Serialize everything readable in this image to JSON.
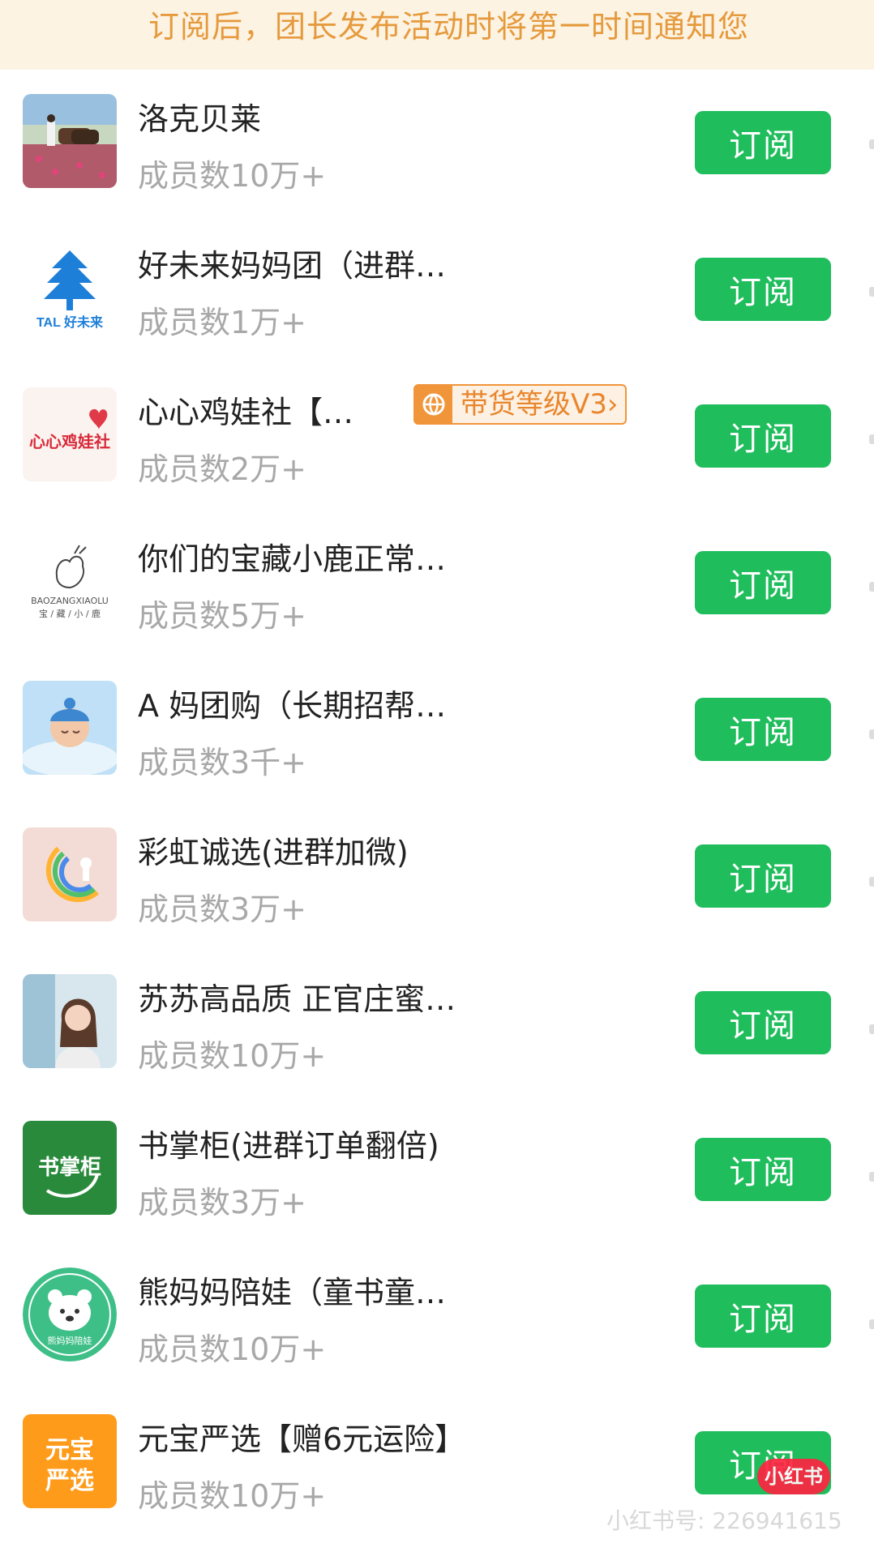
{
  "banner": {
    "text": "订阅后，团长发布活动时将第一时间通知您"
  },
  "subscribe_label": "订阅",
  "accent_color": "#1fbd5c",
  "groups": [
    {
      "name": "洛克贝莱",
      "members": "成员数10万+"
    },
    {
      "name": "好未来妈妈团（进群…",
      "members": "成员数1万+",
      "logo_text": "TAL 好未来"
    },
    {
      "name": "心心鸡娃社【…",
      "members": "成员数2万+",
      "badge": "带货等级V3›",
      "logo_text": "心心鸡娃社"
    },
    {
      "name": "你们的宝藏小鹿正常…",
      "members": "成员数5万+",
      "logo_text": "BAOZANGXIAOLU",
      "logo_subtext": "宝 / 藏 / 小 / 鹿"
    },
    {
      "name": "A 妈团购（长期招帮…",
      "members": "成员数3千+"
    },
    {
      "name": "彩虹诚选(进群加微)",
      "members": "成员数3万+"
    },
    {
      "name": "苏苏高品质 正官庄蜜…",
      "members": "成员数10万+"
    },
    {
      "name": "书掌柜(进群订单翻倍)",
      "members": "成员数3万+",
      "logo_text": "书掌柜"
    },
    {
      "name": "熊妈妈陪娃（童书童…",
      "members": "成员数10万+",
      "logo_text": "熊妈妈陪娃"
    },
    {
      "name": "元宝严选【赠6元运险】",
      "members": "成员数10万+",
      "logo_text": "元宝严选"
    }
  ],
  "watermark": {
    "text": "小红书号: 226941615",
    "logo": "小红书"
  }
}
